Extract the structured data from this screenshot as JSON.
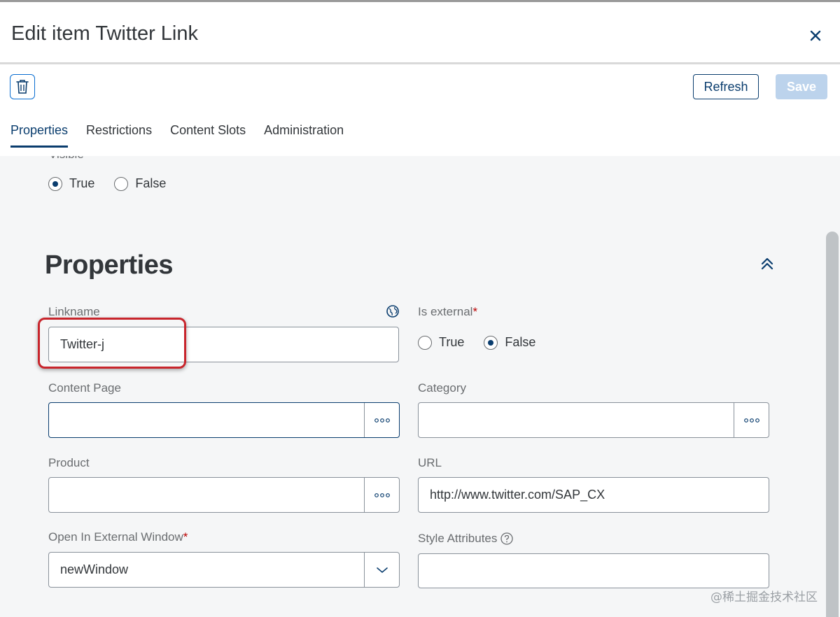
{
  "header": {
    "title": "Edit item Twitter Link"
  },
  "toolbar": {
    "refresh_label": "Refresh",
    "save_label": "Save"
  },
  "tabs": [
    {
      "label": "Properties",
      "active": true
    },
    {
      "label": "Restrictions",
      "active": false
    },
    {
      "label": "Content Slots",
      "active": false
    },
    {
      "label": "Administration",
      "active": false
    }
  ],
  "visible": {
    "label": "Visible",
    "options": [
      "True",
      "False"
    ],
    "selected": "True"
  },
  "section": {
    "title": "Properties"
  },
  "fields": {
    "linkname": {
      "label": "Linkname",
      "value": "Twitter-j"
    },
    "is_external": {
      "label": "Is external",
      "required_mark": "*",
      "options": [
        "True",
        "False"
      ],
      "selected": "False"
    },
    "content_page": {
      "label": "Content Page",
      "value": ""
    },
    "category": {
      "label": "Category",
      "value": ""
    },
    "product": {
      "label": "Product",
      "value": ""
    },
    "url": {
      "label": "URL",
      "value": "http://www.twitter.com/SAP_CX"
    },
    "open_in_external_window": {
      "label": "Open In External Window",
      "required_mark": "*",
      "value": "newWindow"
    },
    "style_attributes": {
      "label": "Style Attributes",
      "value": ""
    }
  },
  "watermark": "@稀土掘金技术社区",
  "colors": {
    "accent": "#0a3d6e",
    "highlight": "#c8252c",
    "required": "#bb0000",
    "save_disabled": "#bcd3ec"
  }
}
